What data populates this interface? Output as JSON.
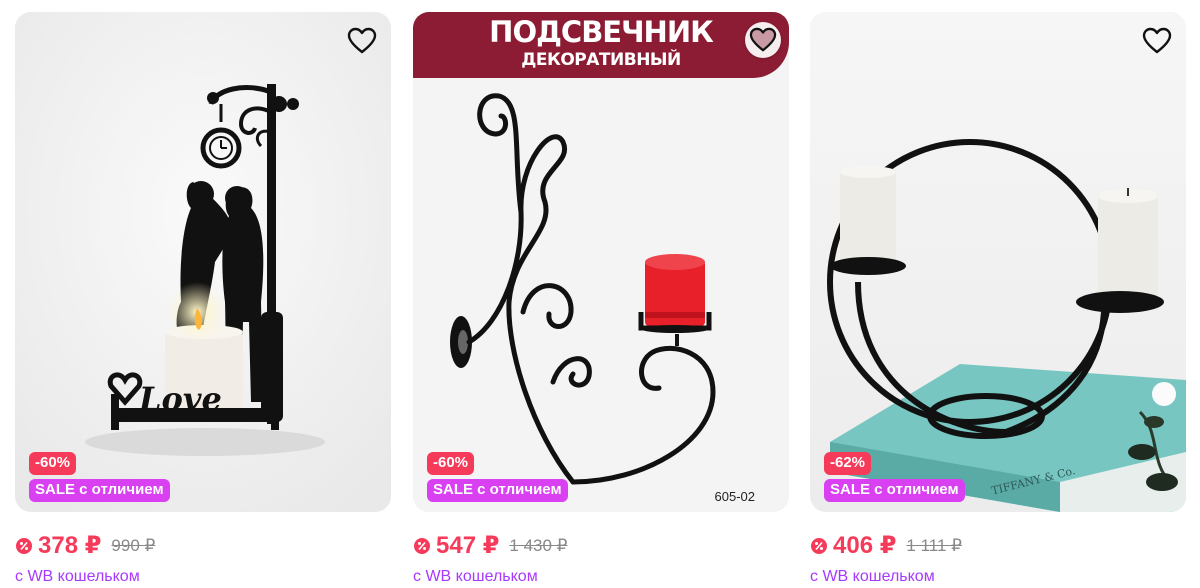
{
  "products": [
    {
      "discount": "-60%",
      "sale_badge": "SALE с отличием",
      "price": "378 ₽",
      "old_price": "990 ₽",
      "wallet_note": "с WB кошельком",
      "favorite_icon": "heart-outline-icon",
      "image_text": "Love"
    },
    {
      "banner_line1": "ПОДСВЕЧНИК",
      "banner_line2": "ДЕКОРАТИВНЫЙ",
      "discount": "-60%",
      "sale_badge": "SALE с отличием",
      "price": "547 ₽",
      "old_price": "1 430 ₽",
      "wallet_note": "с WB кошельком",
      "watermark": "605-02",
      "favorite_icon": "heart-filled-icon"
    },
    {
      "discount": "-62%",
      "sale_badge": "SALE с отличием",
      "price": "406 ₽",
      "old_price": "1 111 ₽",
      "wallet_note": "с WB кошельком",
      "favorite_icon": "heart-outline-icon",
      "image_text": "TIFFANY & Co."
    }
  ],
  "colors": {
    "price": "#f63a5a",
    "discount_badge": "#f63a5a",
    "sale_badge": "#d940f2",
    "wallet_text": "#a73afd",
    "banner": "#8c1c33"
  }
}
